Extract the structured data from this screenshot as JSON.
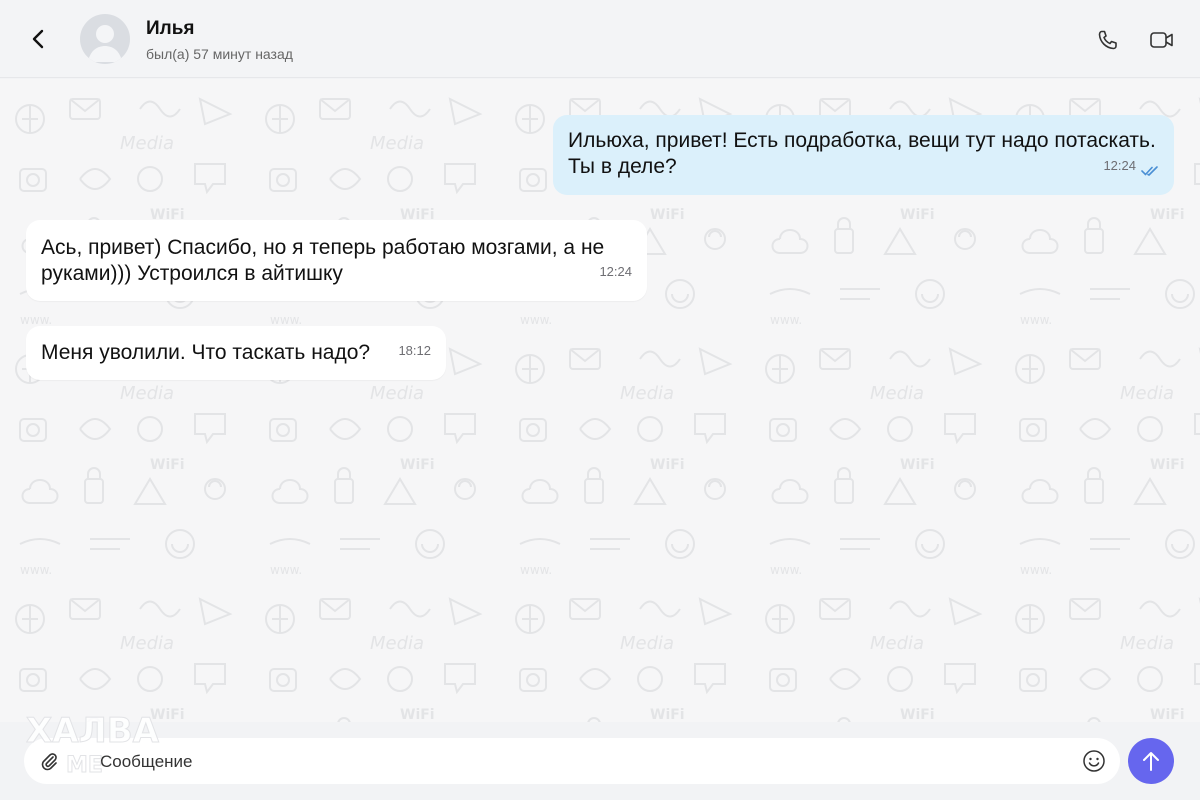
{
  "header": {
    "contact_name": "Илья",
    "status": "был(а) 57 минут назад",
    "icons": {
      "back": "chevron-left-icon",
      "call": "phone-icon",
      "video": "video-camera-icon"
    }
  },
  "messages": [
    {
      "direction": "outgoing",
      "text": "Ильюха, привет! Есть подработка, вещи тут надо потаскать. Ты в деле?",
      "time": "12:24",
      "status": "read"
    },
    {
      "direction": "incoming",
      "text": "Ась, привет) Спасибо, но я теперь работаю мозгами, а не руками))) Устроился в айтишку",
      "time": "12:24"
    },
    {
      "direction": "incoming",
      "text": "Меня уволили. Что таскать надо?",
      "time": "18:12"
    }
  ],
  "composer": {
    "placeholder": "Сообщение",
    "value": "",
    "icons": {
      "attach": "paperclip-icon",
      "emoji": "smiley-icon",
      "send": "arrow-up-icon"
    }
  },
  "watermark": {
    "line1": "ХАЛВА",
    "line2": "МЕ"
  },
  "colors": {
    "outgoing_bubble": "#dbf0fb",
    "incoming_bubble": "#ffffff",
    "send_button": "#6666ee",
    "read_check": "#4a8fd4"
  }
}
